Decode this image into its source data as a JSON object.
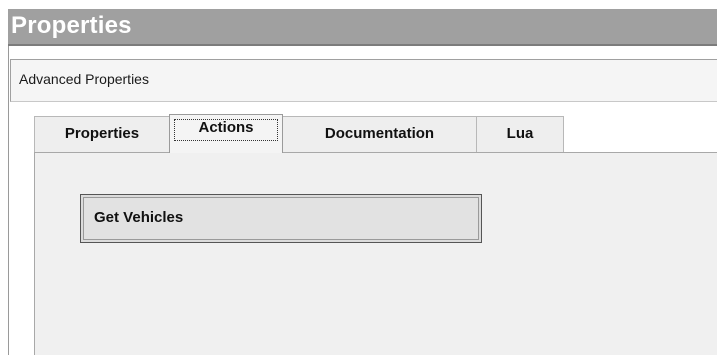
{
  "panel": {
    "title": "Properties",
    "subheader": "Advanced Properties"
  },
  "tabs": [
    {
      "label": "Properties",
      "active": false
    },
    {
      "label": "Actions",
      "active": true
    },
    {
      "label": "Documentation",
      "active": false
    },
    {
      "label": "Lua",
      "active": false
    }
  ],
  "actions": {
    "buttons": [
      {
        "label": "Get Vehicles"
      }
    ]
  }
}
